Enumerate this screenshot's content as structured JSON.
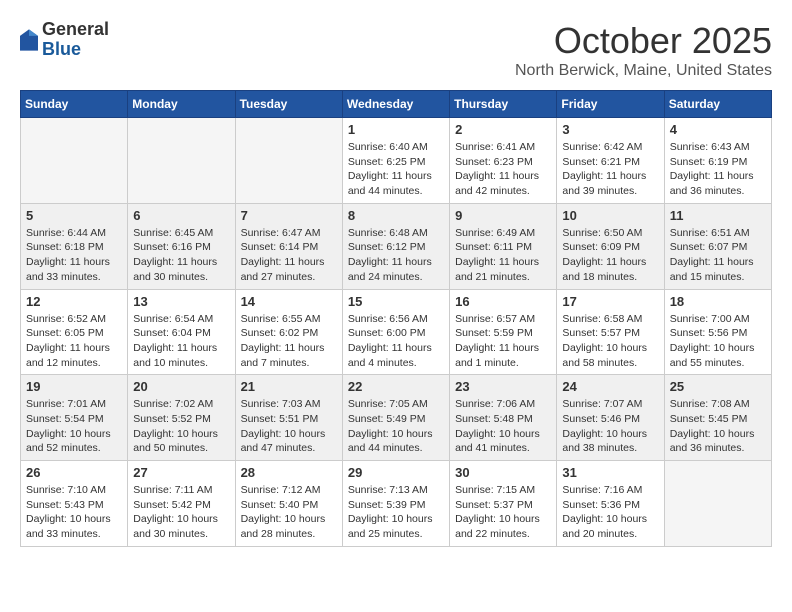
{
  "header": {
    "logo": {
      "general": "General",
      "blue": "Blue"
    },
    "title": "October 2025",
    "location": "North Berwick, Maine, United States"
  },
  "weekdays": [
    "Sunday",
    "Monday",
    "Tuesday",
    "Wednesday",
    "Thursday",
    "Friday",
    "Saturday"
  ],
  "weeks": [
    [
      {
        "day": "",
        "info": ""
      },
      {
        "day": "",
        "info": ""
      },
      {
        "day": "",
        "info": ""
      },
      {
        "day": "1",
        "info": "Sunrise: 6:40 AM\nSunset: 6:25 PM\nDaylight: 11 hours\nand 44 minutes."
      },
      {
        "day": "2",
        "info": "Sunrise: 6:41 AM\nSunset: 6:23 PM\nDaylight: 11 hours\nand 42 minutes."
      },
      {
        "day": "3",
        "info": "Sunrise: 6:42 AM\nSunset: 6:21 PM\nDaylight: 11 hours\nand 39 minutes."
      },
      {
        "day": "4",
        "info": "Sunrise: 6:43 AM\nSunset: 6:19 PM\nDaylight: 11 hours\nand 36 minutes."
      }
    ],
    [
      {
        "day": "5",
        "info": "Sunrise: 6:44 AM\nSunset: 6:18 PM\nDaylight: 11 hours\nand 33 minutes."
      },
      {
        "day": "6",
        "info": "Sunrise: 6:45 AM\nSunset: 6:16 PM\nDaylight: 11 hours\nand 30 minutes."
      },
      {
        "day": "7",
        "info": "Sunrise: 6:47 AM\nSunset: 6:14 PM\nDaylight: 11 hours\nand 27 minutes."
      },
      {
        "day": "8",
        "info": "Sunrise: 6:48 AM\nSunset: 6:12 PM\nDaylight: 11 hours\nand 24 minutes."
      },
      {
        "day": "9",
        "info": "Sunrise: 6:49 AM\nSunset: 6:11 PM\nDaylight: 11 hours\nand 21 minutes."
      },
      {
        "day": "10",
        "info": "Sunrise: 6:50 AM\nSunset: 6:09 PM\nDaylight: 11 hours\nand 18 minutes."
      },
      {
        "day": "11",
        "info": "Sunrise: 6:51 AM\nSunset: 6:07 PM\nDaylight: 11 hours\nand 15 minutes."
      }
    ],
    [
      {
        "day": "12",
        "info": "Sunrise: 6:52 AM\nSunset: 6:05 PM\nDaylight: 11 hours\nand 12 minutes."
      },
      {
        "day": "13",
        "info": "Sunrise: 6:54 AM\nSunset: 6:04 PM\nDaylight: 11 hours\nand 10 minutes."
      },
      {
        "day": "14",
        "info": "Sunrise: 6:55 AM\nSunset: 6:02 PM\nDaylight: 11 hours\nand 7 minutes."
      },
      {
        "day": "15",
        "info": "Sunrise: 6:56 AM\nSunset: 6:00 PM\nDaylight: 11 hours\nand 4 minutes."
      },
      {
        "day": "16",
        "info": "Sunrise: 6:57 AM\nSunset: 5:59 PM\nDaylight: 11 hours\nand 1 minute."
      },
      {
        "day": "17",
        "info": "Sunrise: 6:58 AM\nSunset: 5:57 PM\nDaylight: 10 hours\nand 58 minutes."
      },
      {
        "day": "18",
        "info": "Sunrise: 7:00 AM\nSunset: 5:56 PM\nDaylight: 10 hours\nand 55 minutes."
      }
    ],
    [
      {
        "day": "19",
        "info": "Sunrise: 7:01 AM\nSunset: 5:54 PM\nDaylight: 10 hours\nand 52 minutes."
      },
      {
        "day": "20",
        "info": "Sunrise: 7:02 AM\nSunset: 5:52 PM\nDaylight: 10 hours\nand 50 minutes."
      },
      {
        "day": "21",
        "info": "Sunrise: 7:03 AM\nSunset: 5:51 PM\nDaylight: 10 hours\nand 47 minutes."
      },
      {
        "day": "22",
        "info": "Sunrise: 7:05 AM\nSunset: 5:49 PM\nDaylight: 10 hours\nand 44 minutes."
      },
      {
        "day": "23",
        "info": "Sunrise: 7:06 AM\nSunset: 5:48 PM\nDaylight: 10 hours\nand 41 minutes."
      },
      {
        "day": "24",
        "info": "Sunrise: 7:07 AM\nSunset: 5:46 PM\nDaylight: 10 hours\nand 38 minutes."
      },
      {
        "day": "25",
        "info": "Sunrise: 7:08 AM\nSunset: 5:45 PM\nDaylight: 10 hours\nand 36 minutes."
      }
    ],
    [
      {
        "day": "26",
        "info": "Sunrise: 7:10 AM\nSunset: 5:43 PM\nDaylight: 10 hours\nand 33 minutes."
      },
      {
        "day": "27",
        "info": "Sunrise: 7:11 AM\nSunset: 5:42 PM\nDaylight: 10 hours\nand 30 minutes."
      },
      {
        "day": "28",
        "info": "Sunrise: 7:12 AM\nSunset: 5:40 PM\nDaylight: 10 hours\nand 28 minutes."
      },
      {
        "day": "29",
        "info": "Sunrise: 7:13 AM\nSunset: 5:39 PM\nDaylight: 10 hours\nand 25 minutes."
      },
      {
        "day": "30",
        "info": "Sunrise: 7:15 AM\nSunset: 5:37 PM\nDaylight: 10 hours\nand 22 minutes."
      },
      {
        "day": "31",
        "info": "Sunrise: 7:16 AM\nSunset: 5:36 PM\nDaylight: 10 hours\nand 20 minutes."
      },
      {
        "day": "",
        "info": ""
      }
    ]
  ]
}
